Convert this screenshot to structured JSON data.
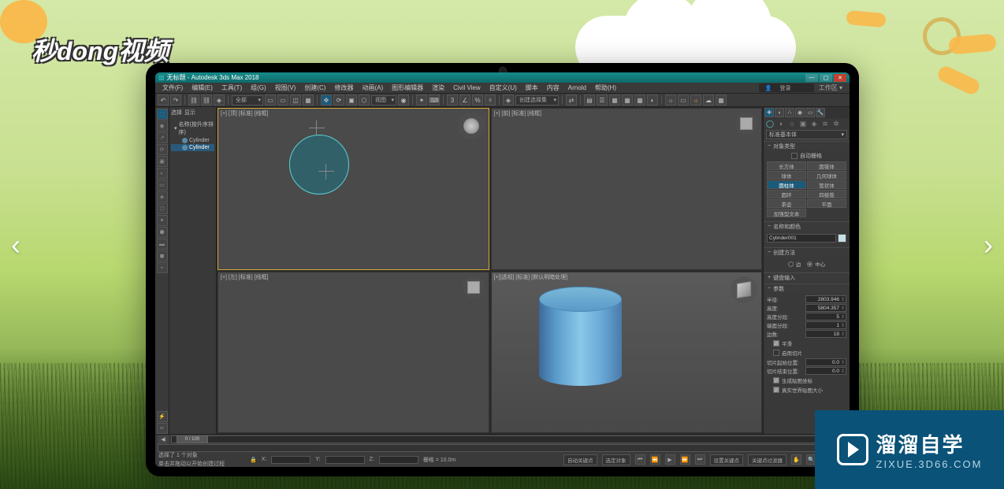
{
  "watermark": {
    "top_left": "秒dong视频",
    "corner_main": "溜溜自学",
    "corner_sub": "ZIXUE.3D66.COM"
  },
  "nav": {
    "prev": "‹",
    "next": "›"
  },
  "titlebar": {
    "title": "无标题 - Autodesk 3ds Max 2018",
    "min": "—",
    "max": "▢",
    "close": "✕"
  },
  "menubar": {
    "items": [
      "文件(F)",
      "编辑(E)",
      "工具(T)",
      "组(G)",
      "视图(V)",
      "创建(C)",
      "修改器",
      "动画(A)",
      "图形编辑器",
      "渲染",
      "Civil View",
      "自定义(U)",
      "脚本",
      "内容",
      "Arnold",
      "帮助(H)"
    ],
    "search_placeholder": "登录",
    "workspace": "工作区 ▾"
  },
  "toolbar": {
    "dd_ref": "视图",
    "dd_snap": "创建选择集"
  },
  "scene": {
    "label1": "选择",
    "label2": "显示",
    "root": "名称(按升序排序)",
    "item1": "Cylinder",
    "item2": "Cylinder"
  },
  "viewports": {
    "top": "[+] [顶] [标准] [线框]",
    "front": "[+] [前] [标准] [线框]",
    "left": "[+] [左] [标准] [线框]",
    "persp": "[+][透视] [标准] [默认明暗处理]"
  },
  "panel": {
    "category_dd": "标准基本体",
    "rollout_type": "对象类型",
    "autogrid": "自动栅格",
    "prim": {
      "box": "长方体",
      "cone": "圆锥体",
      "sphere": "球体",
      "geosphere": "几何球体",
      "cylinder": "圆柱体",
      "tube": "管状体",
      "torus": "圆环",
      "pyramid": "四棱锥",
      "teapot": "茶壶",
      "plane": "平面",
      "textplus": "加强型文本"
    },
    "rollout_name": "名称和颜色",
    "object_name": "Cylinder001",
    "rollout_create": "创建方法",
    "edge": "边",
    "center": "中心",
    "rollout_keyboard": "键盘输入",
    "rollout_params": "参数",
    "params": {
      "radius": "半径:",
      "radius_v": "2803.946",
      "height": "高度:",
      "height_v": "5804.357",
      "heightsegs": "高度分段:",
      "heightsegs_v": "5",
      "capsegs": "端面分段:",
      "capsegs_v": "1",
      "sides": "边数:",
      "sides_v": "18"
    },
    "smooth": "平滑",
    "slice_on": "启用切片",
    "slice_from": "切片起始位置:",
    "slice_from_v": "0.0",
    "slice_to": "切片结束位置:",
    "slice_to_v": "0.0",
    "gen_uv": "生成贴图坐标",
    "real_world": "真实世界贴图大小"
  },
  "timeline": {
    "frame": "0 / 100"
  },
  "status": {
    "sel": "选择了 1 个对象",
    "hint": "单击并拖动以开始创建过程",
    "x": "X:",
    "y": "Y:",
    "z": "Z:",
    "grid": "栅格 = 10.0m",
    "autokey": "自动关键点",
    "setkey": "设置关键点",
    "filter": "选定对象",
    "keyfilter": "关键点过滤器"
  }
}
